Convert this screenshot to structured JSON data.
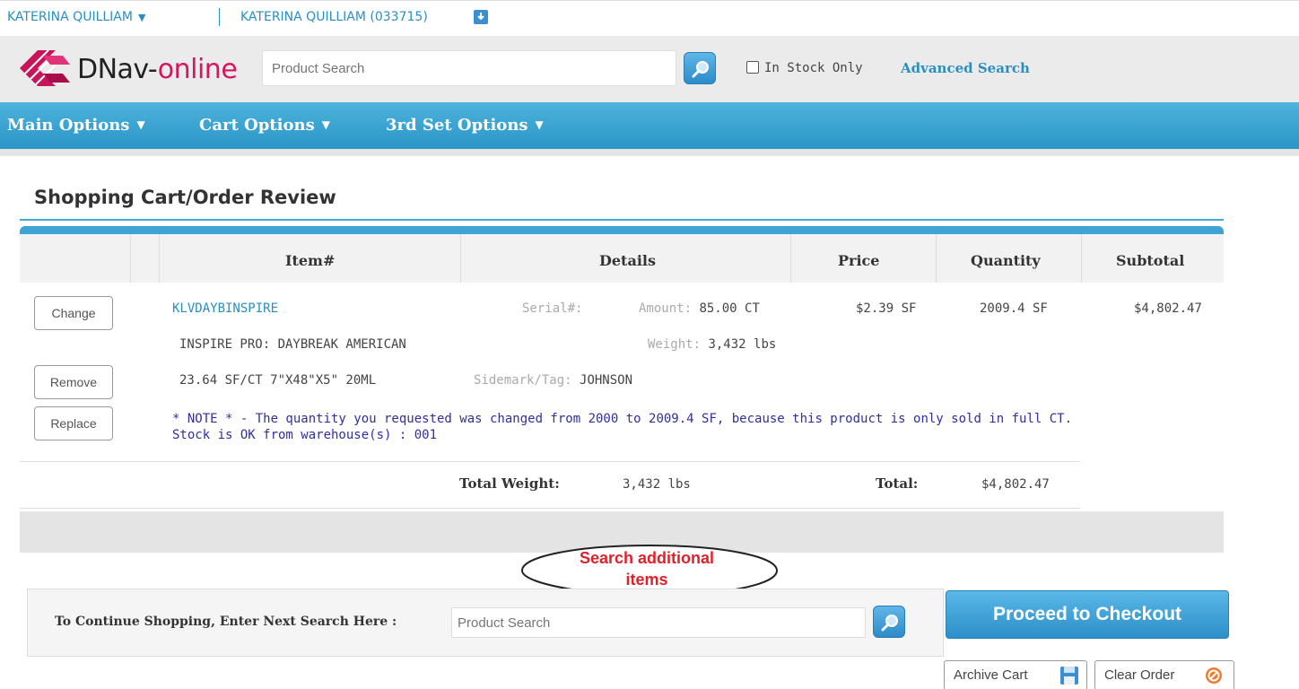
{
  "userbar": {
    "user_name": "KATERINA QUILLIAM",
    "user_caret": "▼",
    "account_label": "KATERINA QUILLIAM (033715)"
  },
  "header": {
    "logo_dn": "DNav-",
    "logo_online": "online",
    "search_placeholder": "Product Search",
    "in_stock_label": "In Stock Only",
    "advanced_search": "Advanced Search"
  },
  "nav": {
    "items": [
      {
        "label": "Main Options"
      },
      {
        "label": "Cart Options"
      },
      {
        "label": "3rd Set Options"
      }
    ],
    "caret": "▼"
  },
  "page": {
    "title": "Shopping Cart/Order Review"
  },
  "table": {
    "headers": [
      "Item#",
      "Details",
      "Price",
      "Quantity",
      "Subtotal"
    ],
    "row": {
      "buttons": {
        "change": "Change",
        "remove": "Remove",
        "replace": "Replace"
      },
      "item_number": "KLVDAYBINSPIRE",
      "description_1": "INSPIRE PRO: DAYBREAK AMERICAN",
      "description_2": "23.64 SF/CT 7\"X48\"X5\" 20ML",
      "serial_label": "Serial#:",
      "amount_label": "Amount:",
      "amount_value": "85.00 CT",
      "weight_label": "Weight:",
      "weight_value": "3,432 lbs",
      "sidemark_label": "Sidemark/Tag:",
      "sidemark_value": "JOHNSON",
      "price": "$2.39 SF",
      "quantity": "2009.4 SF",
      "subtotal": "$4,802.47",
      "note_1": "* NOTE * - The quantity you requested was changed from 2000 to 2009.4 SF, because this product is only sold in full CT.",
      "note_2": "Stock is OK from warehouse(s) : 001"
    },
    "totals": {
      "weight_label": "Total Weight:",
      "weight_value": "3,432 lbs",
      "total_label": "Total:",
      "total_value": "$4,802.47"
    }
  },
  "callout": {
    "line_1": "Search additional",
    "line_2": "items"
  },
  "continue": {
    "label": "To Continue Shopping, Enter Next Search Here :",
    "search_placeholder": "Product Search"
  },
  "actions": {
    "checkout": "Proceed to Checkout",
    "archive": "Archive Cart",
    "clear": "Clear Order"
  },
  "colors": {
    "accent_blue": "#2a95c6",
    "brand_pink": "#d6145f",
    "note_blue": "#2f2f9e",
    "callout_red": "#e0202a"
  },
  "icons": [
    "dropdown-caret-icon",
    "download-icon",
    "dnav-logo-icon",
    "search-magnifier-icon",
    "save-floppy-icon",
    "clear-prohibited-icon"
  ]
}
